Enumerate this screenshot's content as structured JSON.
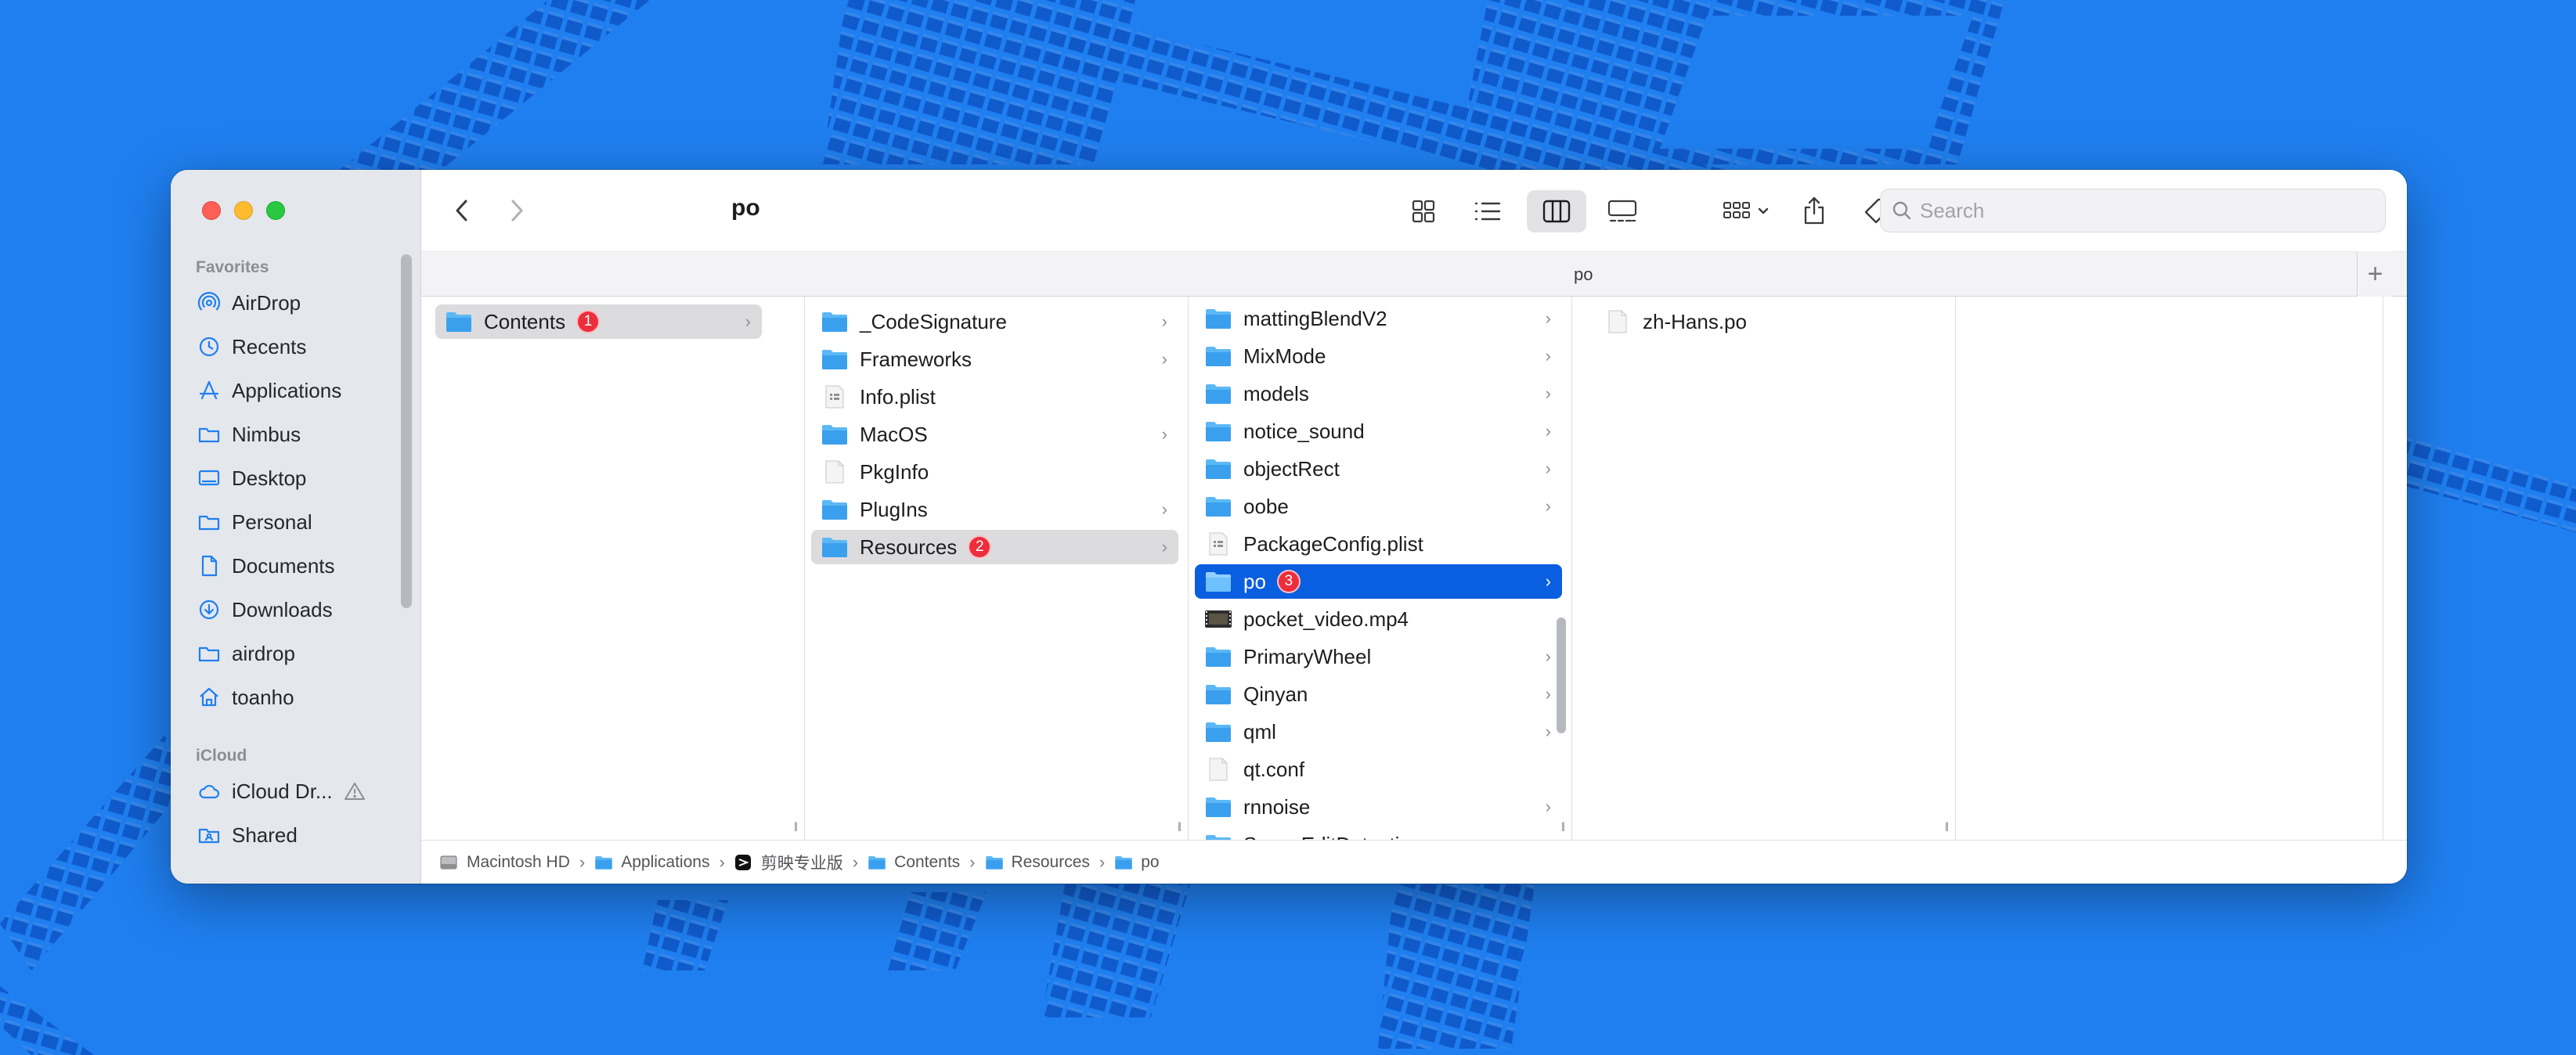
{
  "window": {
    "title": "po"
  },
  "sidebar": {
    "favorites_header": "Favorites",
    "favorites": [
      {
        "label": "AirDrop",
        "icon": "airdrop-icon"
      },
      {
        "label": "Recents",
        "icon": "clock-icon"
      },
      {
        "label": "Applications",
        "icon": "applications-icon"
      },
      {
        "label": "Nimbus",
        "icon": "folder-icon"
      },
      {
        "label": "Desktop",
        "icon": "desktop-icon"
      },
      {
        "label": "Personal",
        "icon": "folder-icon"
      },
      {
        "label": "Documents",
        "icon": "document-icon"
      },
      {
        "label": "Downloads",
        "icon": "download-icon"
      },
      {
        "label": "airdrop",
        "icon": "folder-icon"
      },
      {
        "label": "toanho",
        "icon": "home-icon"
      }
    ],
    "icloud_header": "iCloud",
    "icloud": [
      {
        "label": "iCloud Dr...",
        "icon": "cloud-icon",
        "warning": true
      },
      {
        "label": "Shared",
        "icon": "shared-folder-icon"
      }
    ]
  },
  "toolbar": {
    "search_placeholder": "Search"
  },
  "path_title": "po",
  "columns": [
    {
      "items": [
        {
          "name": "Contents",
          "type": "folder",
          "chevron": true,
          "badge": "1",
          "selected": "gray"
        }
      ]
    },
    {
      "items": [
        {
          "name": "_CodeSignature",
          "type": "folder",
          "chevron": true
        },
        {
          "name": "Frameworks",
          "type": "folder",
          "chevron": true
        },
        {
          "name": "Info.plist",
          "type": "plist",
          "chevron": false
        },
        {
          "name": "MacOS",
          "type": "folder",
          "chevron": true
        },
        {
          "name": "PkgInfo",
          "type": "file",
          "chevron": false
        },
        {
          "name": "PlugIns",
          "type": "folder",
          "chevron": true
        },
        {
          "name": "Resources",
          "type": "folder",
          "chevron": true,
          "badge": "2",
          "selected": "gray"
        }
      ]
    },
    {
      "items": [
        {
          "name": "mattingBlendV2",
          "type": "folder",
          "chevron": true
        },
        {
          "name": "MixMode",
          "type": "folder",
          "chevron": true
        },
        {
          "name": "models",
          "type": "folder",
          "chevron": true
        },
        {
          "name": "notice_sound",
          "type": "folder",
          "chevron": true
        },
        {
          "name": "objectRect",
          "type": "folder",
          "chevron": true
        },
        {
          "name": "oobe",
          "type": "folder",
          "chevron": true
        },
        {
          "name": "PackageConfig.plist",
          "type": "plist",
          "chevron": false
        },
        {
          "name": "po",
          "type": "folder",
          "chevron": true,
          "badge": "3",
          "selected": "blue"
        },
        {
          "name": "pocket_video.mp4",
          "type": "video",
          "chevron": false
        },
        {
          "name": "PrimaryWheel",
          "type": "folder",
          "chevron": true
        },
        {
          "name": "Qinyan",
          "type": "folder",
          "chevron": true
        },
        {
          "name": "qml",
          "type": "folder",
          "chevron": true
        },
        {
          "name": "qt.conf",
          "type": "file",
          "chevron": false
        },
        {
          "name": "rnnoise",
          "type": "folder",
          "chevron": true
        },
        {
          "name": "SceneEditDetection",
          "type": "folder",
          "chevron": true
        }
      ]
    },
    {
      "items": [
        {
          "name": "zh-Hans.po",
          "type": "file",
          "chevron": false
        }
      ]
    },
    {
      "items": []
    }
  ],
  "pathbar": [
    {
      "label": "Macintosh HD",
      "icon": "hard-drive-icon"
    },
    {
      "label": "Applications",
      "icon": "folder-icon"
    },
    {
      "label": "剪映专业版",
      "icon": "app-icon"
    },
    {
      "label": "Contents",
      "icon": "folder-icon"
    },
    {
      "label": "Resources",
      "icon": "folder-icon"
    },
    {
      "label": "po",
      "icon": "folder-icon"
    }
  ],
  "colors": {
    "selection_blue": "#0a5ee0",
    "selection_gray": "#dcdcde",
    "folder_blue": "#5cb8f5",
    "badge_red": "#ec2e3c",
    "wallpaper": "#1f7ff0"
  }
}
